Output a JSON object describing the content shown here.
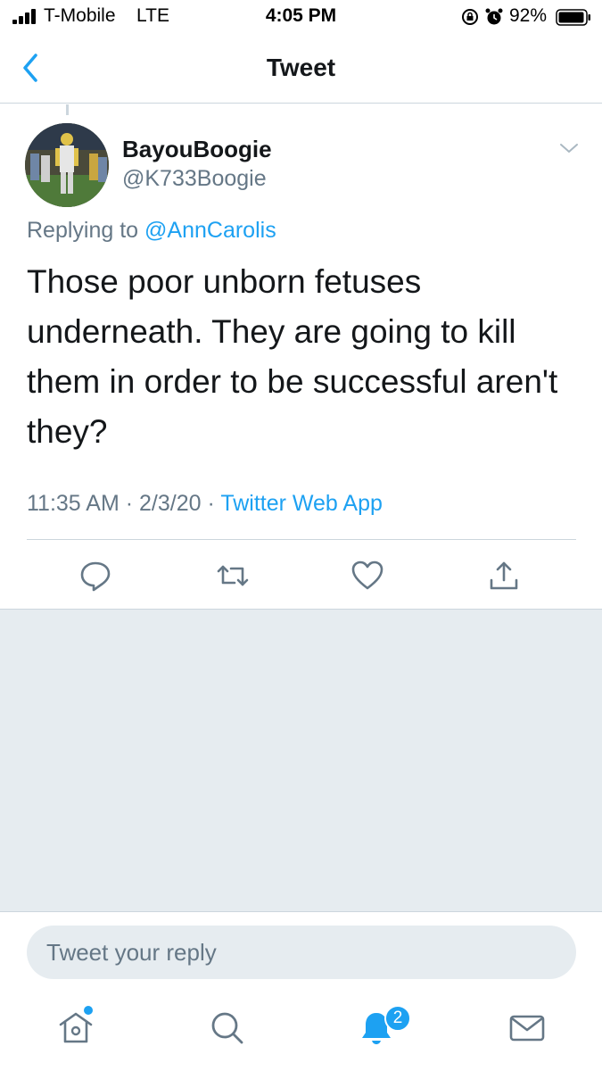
{
  "status_bar": {
    "carrier": "T-Mobile",
    "network": "LTE",
    "time": "4:05 PM",
    "battery": "92%",
    "icons": [
      "signal-icon",
      "orientation-lock-icon",
      "alarm-icon",
      "battery-icon"
    ]
  },
  "nav": {
    "title": "Tweet",
    "back_icon": "chevron-left-icon"
  },
  "tweet": {
    "display_name": "BayouBoogie",
    "handle": "@K733Boogie",
    "replying_prefix": "Replying to",
    "replying_to": "@AnnCarolis",
    "text": "Those poor unborn fetuses underneath.  They are going to kill them in order to be successful aren't they?",
    "time": "11:35 AM",
    "separator": "·",
    "date": "2/3/20",
    "source": "Twitter Web App",
    "actions": [
      "reply-icon",
      "retweet-icon",
      "like-icon",
      "share-icon"
    ]
  },
  "reply_box": {
    "placeholder": "Tweet your reply"
  },
  "tab_bar": {
    "tabs": [
      "home-icon",
      "search-icon",
      "notifications-icon",
      "messages-icon"
    ],
    "notification_count": "2"
  },
  "colors": {
    "accent": "#1da1f2",
    "secondary_text": "#657786",
    "divider": "#ccd6dd",
    "background_gray": "#e6ecf0"
  }
}
